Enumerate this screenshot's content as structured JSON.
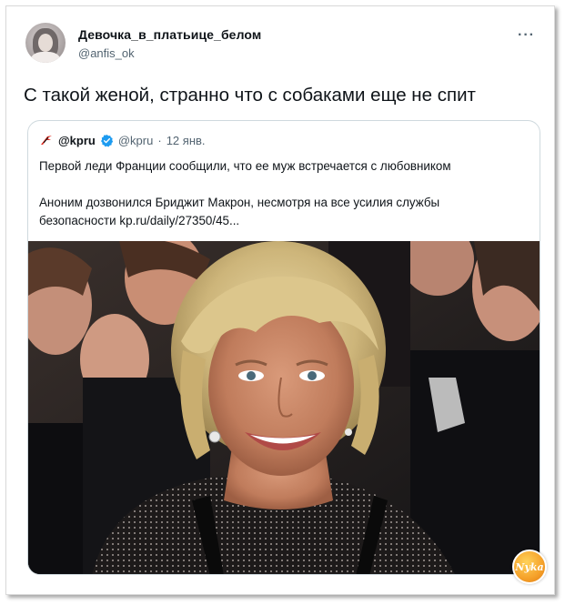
{
  "tweet": {
    "author_name": "Девочка_в_платьице_белом",
    "author_handle": "@anfis_ok",
    "more_label": "···",
    "text": "С такой женой, странно что с собаками еще не спит"
  },
  "quoted": {
    "logo_icon": "kp-logo-icon",
    "name": "@kpru",
    "verified_icon": "verified-badge-icon",
    "handle": "@kpru",
    "separator": "·",
    "date": "12 янв.",
    "line1": "Первой леди Франции сообщили, что ее муж встречается с любовником",
    "line2": "Аноним дозвонился Бриджит Макрон, несмотря на все усилия службы",
    "line3": "безопасности kp.ru/daily/27350/45..."
  },
  "watermark": {
    "text": "Nyka"
  },
  "colors": {
    "text": "#0f1419",
    "secondary": "#536471",
    "border": "#cfd9de",
    "verified": "#1d9bf0",
    "kp_red": "#e0281d"
  }
}
